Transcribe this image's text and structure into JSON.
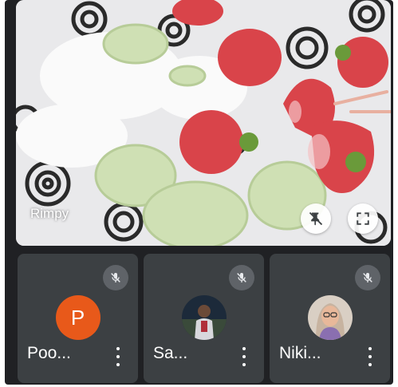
{
  "main_video": {
    "participant_name": "Rimpy",
    "pin_icon": "pin-off-icon",
    "fullscreen_icon": "fullscreen-icon"
  },
  "tiles": [
    {
      "name": "Poo...",
      "avatar_letter": "P",
      "avatar_color": "#e8591a",
      "muted": true
    },
    {
      "name": "Sa...",
      "avatar_type": "photo",
      "muted": true
    },
    {
      "name": "Niki...",
      "avatar_type": "photo",
      "muted": true
    }
  ],
  "colors": {
    "background": "#202124",
    "tile": "#3c4043",
    "mute_badge": "#5f6368"
  }
}
